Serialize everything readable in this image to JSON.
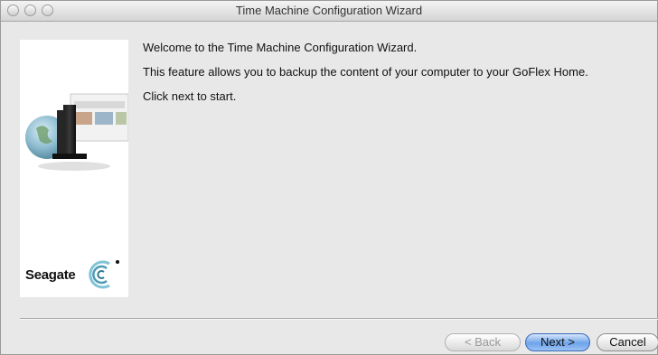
{
  "window": {
    "title": "Time Machine Configuration Wizard"
  },
  "sidebar": {
    "brand": "Seagate"
  },
  "content": {
    "welcome": "Welcome to the Time Machine Configuration Wizard.",
    "description": "This feature allows you to backup the content of your computer to your GoFlex Home.",
    "instruction": "Click next to start."
  },
  "buttons": {
    "back": "< Back",
    "next": "Next >",
    "cancel": "Cancel"
  },
  "colors": {
    "primary_button": "#6ea3ea",
    "window_bg": "#e8e8e8"
  }
}
